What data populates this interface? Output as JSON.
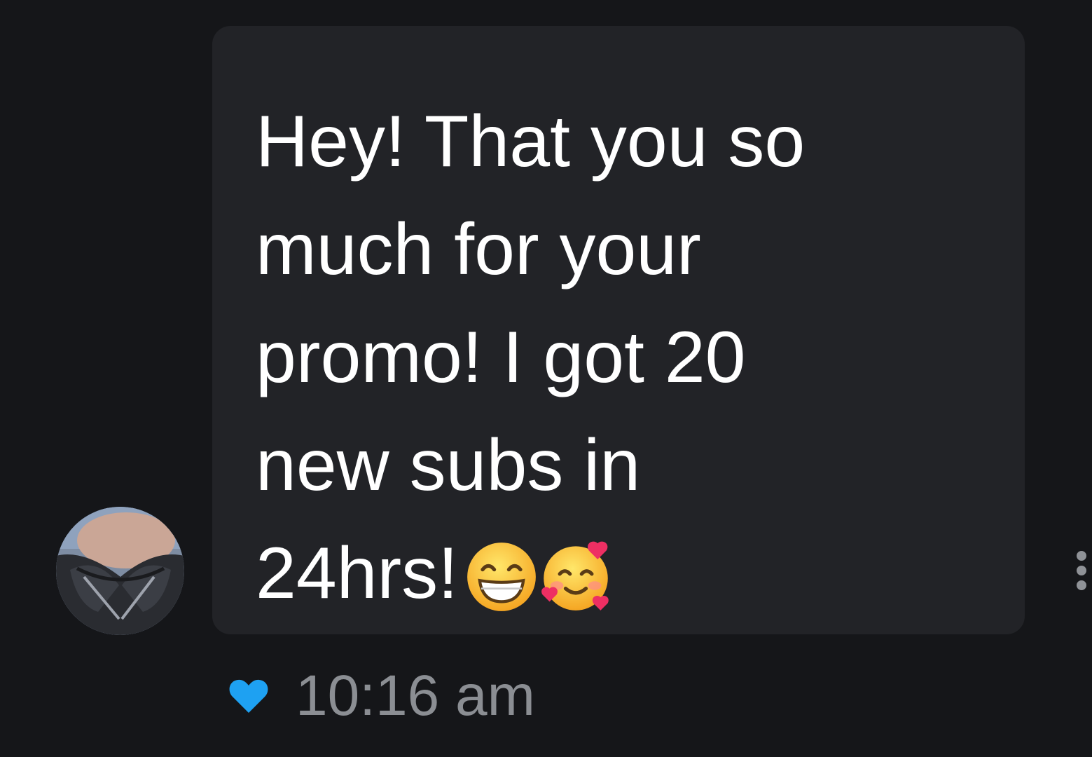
{
  "message": {
    "text": "Hey! That you so\nmuch for your\npromo! I got 20\nnew subs in\n24hrs!",
    "emojis": [
      "beaming-face-with-smiling-eyes",
      "smiling-face-with-hearts"
    ]
  },
  "meta": {
    "liked": true,
    "heart_color": "#1ea1f2",
    "timestamp": "10:16 am"
  },
  "colors": {
    "background": "#151619",
    "bubble": "#222327",
    "text": "#ffffff",
    "timestamp": "#8b8e93"
  }
}
